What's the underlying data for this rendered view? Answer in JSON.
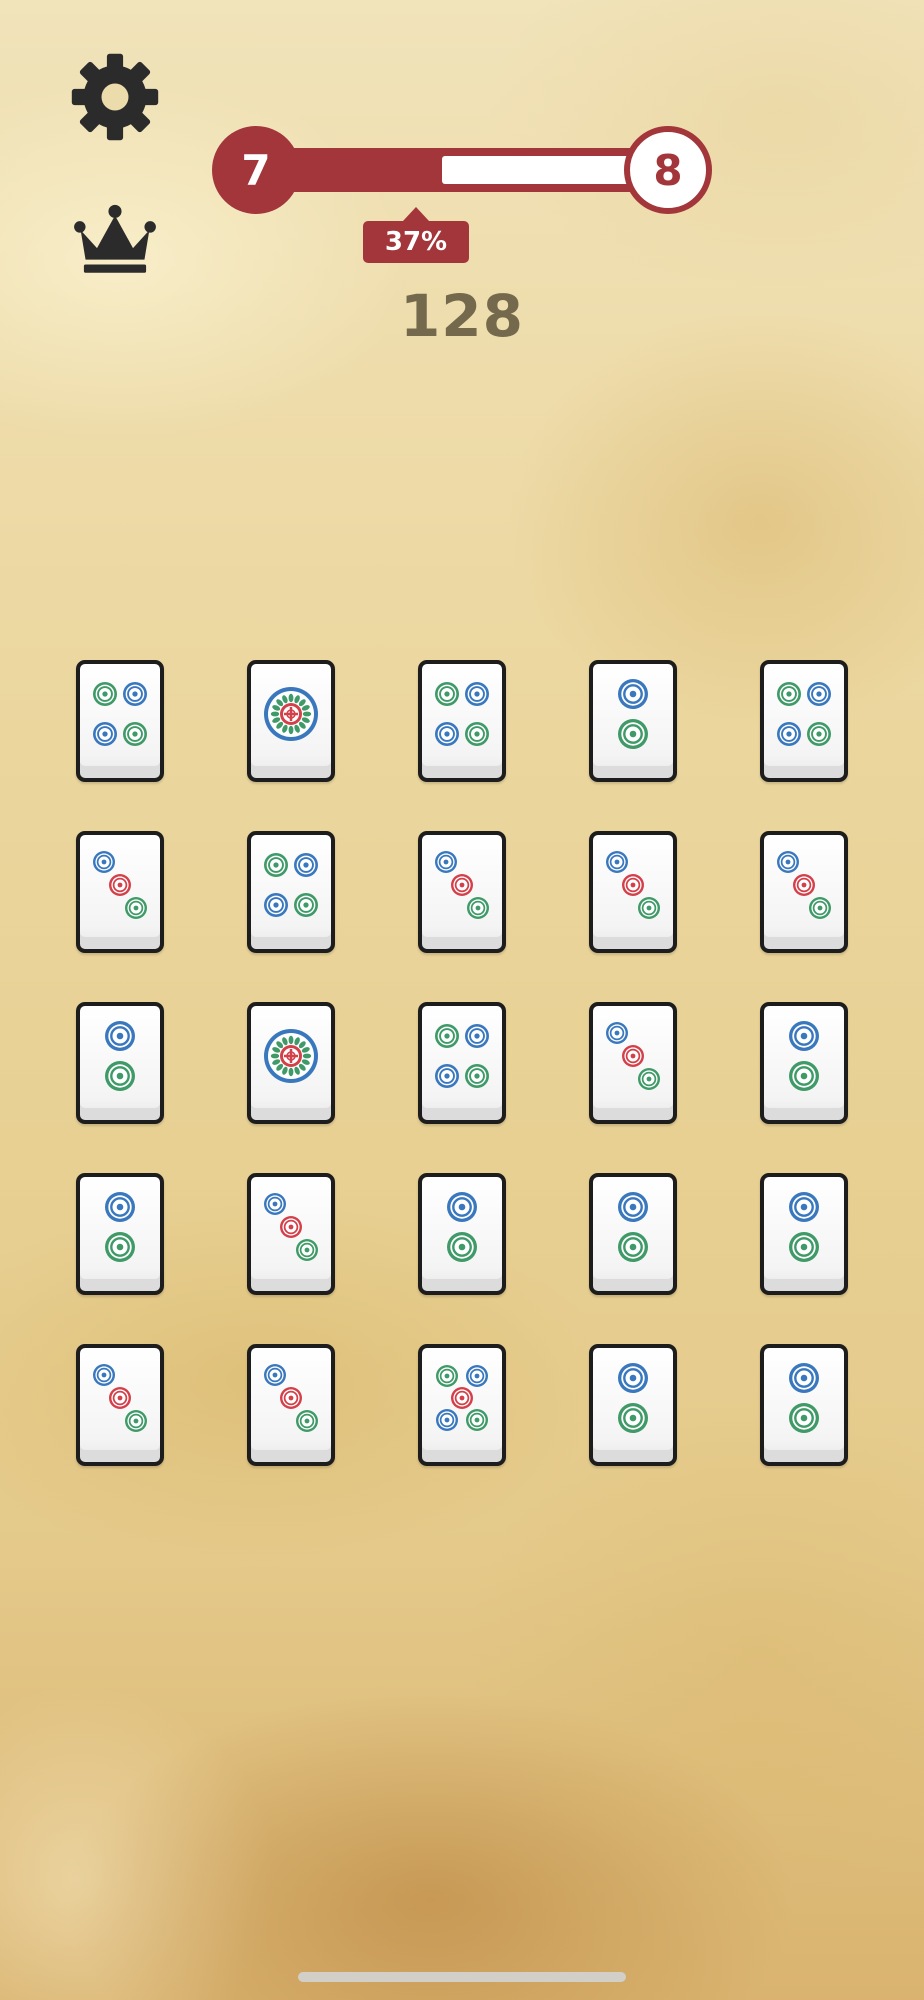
{
  "hud": {
    "level_current": "7",
    "level_next": "8",
    "progress_percent_label": "37%",
    "progress": 0.37,
    "score": "128"
  },
  "icons": {
    "settings": "gear-icon",
    "leaderboard": "crown-icon"
  },
  "colors": {
    "accent": "#a3363a",
    "score_text": "#74694c",
    "dot_blue": "#3a78be",
    "dot_green": "#3f9a68",
    "dot_red": "#d3404a",
    "tile_border": "#1d1d1d"
  },
  "board": {
    "rows": 5,
    "columns": 5,
    "tiles": [
      [
        "four-dots",
        "flower-one-dot",
        "four-dots",
        "two-dots",
        "four-dots"
      ],
      [
        "three-dots",
        "four-dots",
        "three-dots",
        "three-dots",
        "three-dots"
      ],
      [
        "two-dots",
        "flower-one-dot",
        "four-dots",
        "three-dots",
        "two-dots"
      ],
      [
        "two-dots",
        "three-dots",
        "two-dots",
        "two-dots",
        "two-dots"
      ],
      [
        "three-dots",
        "three-dots",
        "five-dots",
        "two-dots",
        "two-dots"
      ]
    ]
  }
}
